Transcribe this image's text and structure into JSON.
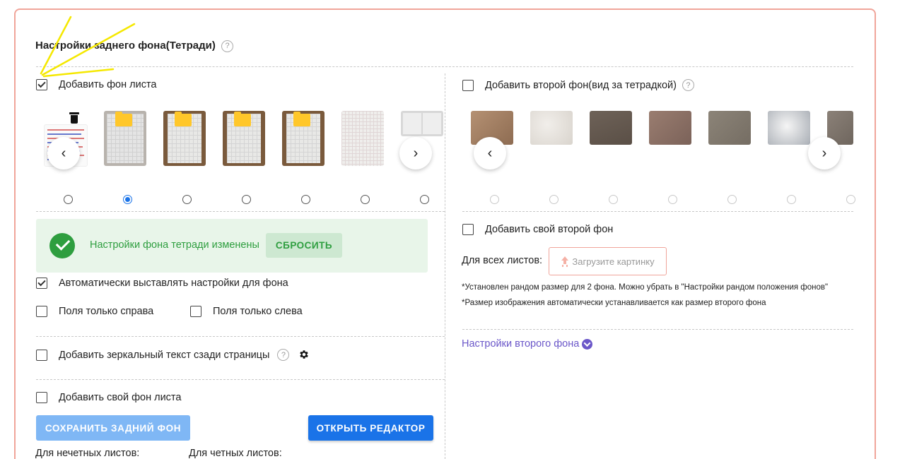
{
  "section": {
    "title": "Настройки заднего фона(Тетради)",
    "help": "?"
  },
  "left": {
    "add_sheet_bg": {
      "label": "Добавить фон листа",
      "checked": true
    },
    "thumbnails": [
      {
        "name": "text-sheet",
        "selected": false
      },
      {
        "name": "notebook-ring-grid",
        "selected": true
      },
      {
        "name": "notebook-spiral-grid-1",
        "selected": false
      },
      {
        "name": "notebook-spiral-grid-2",
        "selected": false
      },
      {
        "name": "notebook-spiral-grid-3",
        "selected": false
      },
      {
        "name": "plain-grid-sheet",
        "selected": false
      },
      {
        "name": "notebook-open",
        "selected": false
      }
    ],
    "success": {
      "message": "Настройки фона тетради изменены",
      "reset_label": "СБРОСИТЬ"
    },
    "auto_settings": {
      "label": "Автоматически выставлять настройки для фона",
      "checked": true
    },
    "margin_right": {
      "label": "Поля только справа",
      "checked": false
    },
    "margin_left": {
      "label": "Поля только слева",
      "checked": false
    },
    "mirror_text": {
      "label": "Добавить зеркальный текст сзади страницы",
      "checked": false,
      "help": "?"
    },
    "own_bg": {
      "label": "Добавить свой фон листа",
      "checked": false
    },
    "save_label": "СОХРАНИТЬ ЗАДНИЙ ФОН",
    "open_editor_label": "ОТКРЫТЬ РЕДАКТОР",
    "odd_sheets": "Для нечетных листов:",
    "even_sheets": "Для четных листов:"
  },
  "right": {
    "second_bg": {
      "label": "Добавить второй фон(вид за тетрадкой)",
      "checked": false,
      "help": "?"
    },
    "own_second_bg": {
      "label": "Добавить свой второй фон",
      "checked": false
    },
    "all_sheets": "Для всех листов:",
    "upload_label": "Загрузите картинку",
    "note1": "*Установлен рандом размер для 2 фона. Можно убрать в \"Настройки рандом положения фонов\"",
    "note2": "*Размер изображения автоматически устанавливается как размер второго фона",
    "second_settings_link": "Настройки второго фона"
  },
  "colors": {
    "border": "#f0a59a",
    "primary": "#1a73e8",
    "success": "#2e9e3f",
    "link": "#6b57c9",
    "disabled_button": "#7fb7f5",
    "annotation": "#f5e800"
  }
}
